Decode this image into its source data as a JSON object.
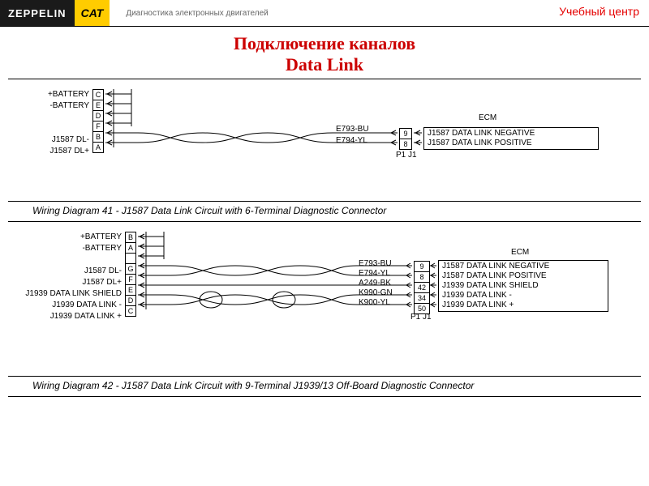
{
  "header": {
    "zeppelin": "ZEPPELIN",
    "cat": "CAT",
    "doc_title": "Диагностика электронных двигателей",
    "training_center": "Учебный центр"
  },
  "title_line1": "Подключение каналов",
  "title_line2": "Data Link",
  "diagram1": {
    "left": {
      "battery_pos": "+BATTERY",
      "battery_neg": "-BATTERY",
      "j1587_neg": "J1587 DL-",
      "j1587_pos": "J1587 DL+"
    },
    "left_pins": [
      "C",
      "E",
      "D",
      "F",
      "B",
      "A"
    ],
    "wires": {
      "e793": "E793-BU",
      "e794": "E794-YL"
    },
    "right_pins": [
      "9",
      "8"
    ],
    "ecm_label": "ECM",
    "ecm_lines": [
      "J1587 DATA LINK NEGATIVE",
      "J1587 DATA LINK POSITIVE"
    ],
    "pj": "P1 J1",
    "caption": "Wiring Diagram 41 -  J1587 Data Link Circuit with 6-Terminal Diagnostic Connector"
  },
  "diagram2": {
    "left": {
      "battery_pos": "+BATTERY",
      "battery_neg": "-BATTERY",
      "j1587_neg": "J1587 DL-",
      "j1587_pos": "J1587 DL+",
      "j1939_shield": "J1939 DATA LINK SHIELD",
      "j1939_neg": "J1939 DATA LINK -",
      "j1939_pos": "J1939 DATA LINK +"
    },
    "left_pins": [
      "B",
      "A",
      "",
      "G",
      "F",
      "E",
      "D",
      "C"
    ],
    "wires": {
      "e793": "E793-BU",
      "e794": "E794-YL",
      "a249": "A249-BK",
      "k990": "K990-GN",
      "k900": "K900-YL"
    },
    "right_pins": [
      "9",
      "8",
      "42",
      "34",
      "50"
    ],
    "ecm_label": "ECM",
    "ecm_lines": [
      "J1587 DATA LINK NEGATIVE",
      "J1587 DATA LINK POSITIVE",
      "J1939 DATA LINK SHIELD",
      "J1939 DATA LINK -",
      "J1939 DATA LINK +"
    ],
    "pj": "P1 J1",
    "caption": "Wiring Diagram 42 -  J1587 Data Link Circuit with 9-Terminal J1939/13 Off-Board Diagnostic Connector"
  }
}
